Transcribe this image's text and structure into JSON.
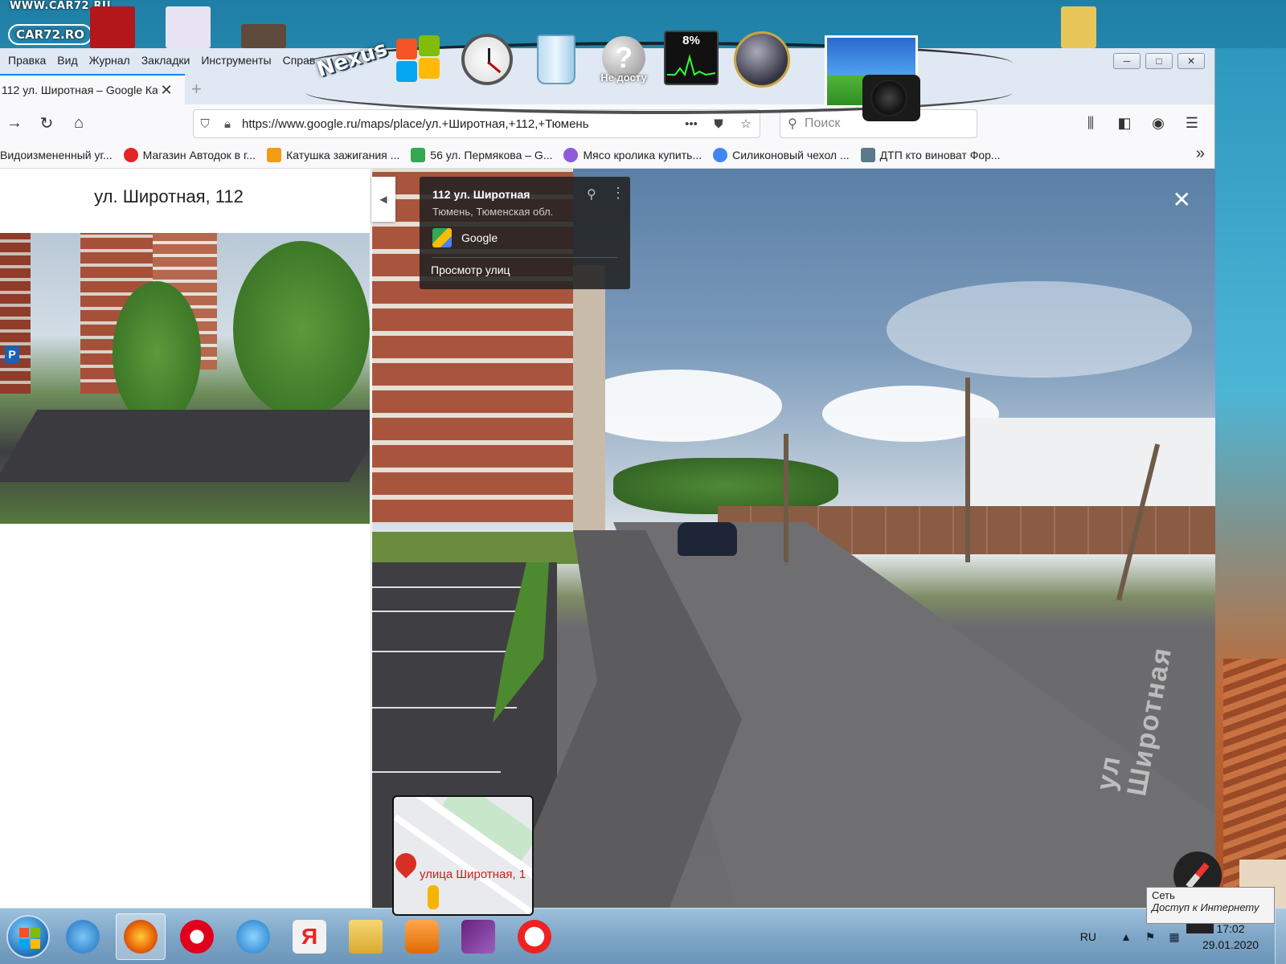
{
  "desktop": {
    "site_logo_top": "WWW.CAR72.RU",
    "site_logo_mid": "CAR72.RO"
  },
  "dock": {
    "nexus_label": "Nexus",
    "help_label": "Не досту",
    "cpu_percent": "8%"
  },
  "menubar": {
    "items": [
      "Правка",
      "Вид",
      "Журнал",
      "Закладки",
      "Инструменты",
      "Справ"
    ]
  },
  "tab": {
    "title": "112 ул. Широтная – Google Ка",
    "close": "✕",
    "new_tab": "+"
  },
  "nav": {
    "back": "←",
    "forward": "→",
    "reload": "↻",
    "home": "⌂",
    "url": "https://www.google.ru/maps/place/ул.+Широтная,+112,+Тюмень",
    "search_placeholder": "Поиск",
    "page_actions": "•••"
  },
  "bookmarks": {
    "items": [
      {
        "label": "Видоизмененный уг...",
        "color": "#ffffff"
      },
      {
        "label": "Магазин Автодок в г...",
        "color": "#e22525"
      },
      {
        "label": "Катушка зажигания ...",
        "color": "#f39c12"
      },
      {
        "label": "56 ул. Пермякова – G...",
        "color": "#34a853"
      },
      {
        "label": "Мясо кролика купить...",
        "color": "#8e5cd9"
      },
      {
        "label": "Силиконовый чехол ...",
        "color": "#4285f4"
      },
      {
        "label": "ДТП кто виноват Фор...",
        "color": "#5a7a8a"
      }
    ],
    "more": "»"
  },
  "left_panel": {
    "place_title": "ул. Широтная, 112",
    "parking_sign": "P"
  },
  "info_card": {
    "title": "112 ул. Широтная",
    "subtitle": "Тюмень, Тюменская обл.",
    "provider": "Google",
    "street_view_label": "Просмотр улиц"
  },
  "street_view": {
    "road_text": "ул Широтная",
    "close": "✕"
  },
  "minimap": {
    "pin_label": "улица Широтная, 1"
  },
  "controls": {
    "zoom_in": "+",
    "collapse": "◀"
  },
  "tooltip": {
    "line1": "Сеть",
    "line2": "Доступ к Интернету"
  },
  "taskbar": {
    "lang": "RU",
    "time": "17:02",
    "date": "29.01.2020"
  },
  "colors": {
    "accent": "#0a84ff",
    "map_pin": "#d93025"
  }
}
